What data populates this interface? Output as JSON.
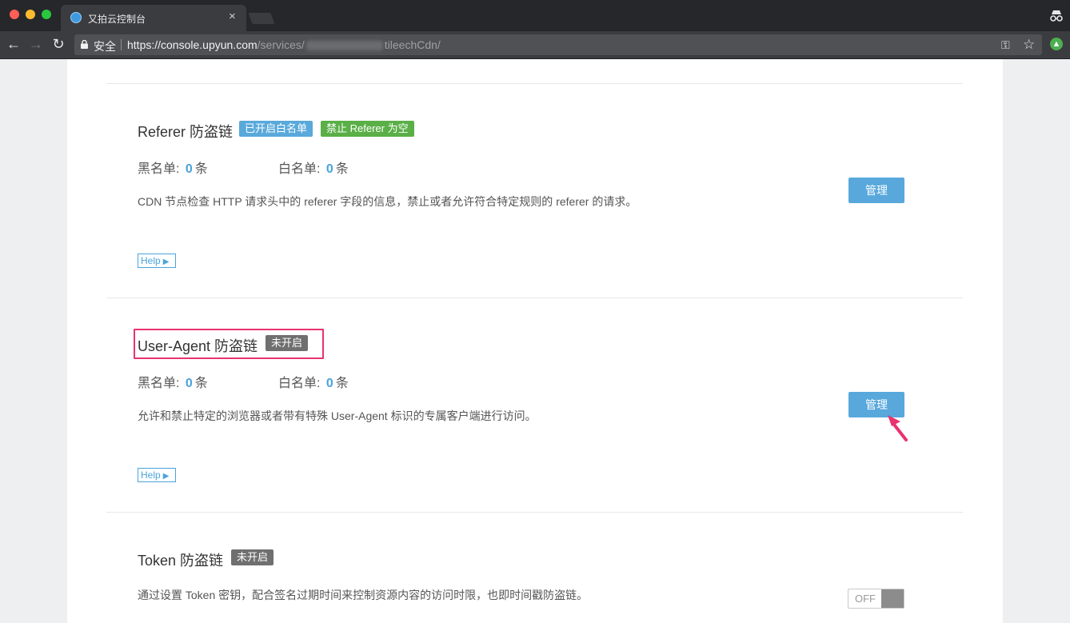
{
  "browser": {
    "tab_title": "又拍云控制台",
    "tab_close": "×",
    "secure_label": "安全",
    "url_host": "https://console.upyun.com",
    "url_path_start": "/services/",
    "url_path_end": "tileechCdn/",
    "back": "←",
    "forward": "→",
    "reload": "↻",
    "star": "☆",
    "key": "⚿",
    "menu": "⋮",
    "ext": "▲"
  },
  "sections": [
    {
      "title": "Referer 防盗链",
      "badges": [
        "已开启白名单",
        "禁止 Referer 为空"
      ],
      "blacklist_label": "黑名单:",
      "blacklist_count": "0",
      "blacklist_unit": "条",
      "whitelist_label": "白名单:",
      "whitelist_count": "0",
      "whitelist_unit": "条",
      "description": "CDN 节点检查 HTTP 请求头中的 referer 字段的信息，禁止或者允许符合特定规则的 referer 的请求。",
      "help_label": "Help",
      "help_arrow": "▶",
      "manage_label": "管理"
    },
    {
      "title": "User-Agent 防盗链",
      "badges": [
        "未开启"
      ],
      "blacklist_label": "黑名单:",
      "blacklist_count": "0",
      "blacklist_unit": "条",
      "whitelist_label": "白名单:",
      "whitelist_count": "0",
      "whitelist_unit": "条",
      "description": "允许和禁止特定的浏览器或者带有特殊 User-Agent 标识的专属客户端进行访问。",
      "help_label": "Help",
      "help_arrow": "▶",
      "manage_label": "管理"
    },
    {
      "title": "Token 防盗链",
      "badges": [
        "未开启"
      ],
      "description": "通过设置 Token 密钥，配合签名过期时间来控制资源内容的访问时限，也即时间戳防盗链。",
      "toggle_label": "OFF"
    }
  ],
  "colors": {
    "accent": "#4aa3dc",
    "button": "#58a8dc",
    "badge_green": "#5aaf47",
    "badge_gray": "#6f6f6f",
    "highlight": "#e8336f"
  },
  "icons": [
    "lock-icon",
    "incognito-icon",
    "key-icon",
    "star-icon",
    "arrow-cursor-icon"
  ]
}
